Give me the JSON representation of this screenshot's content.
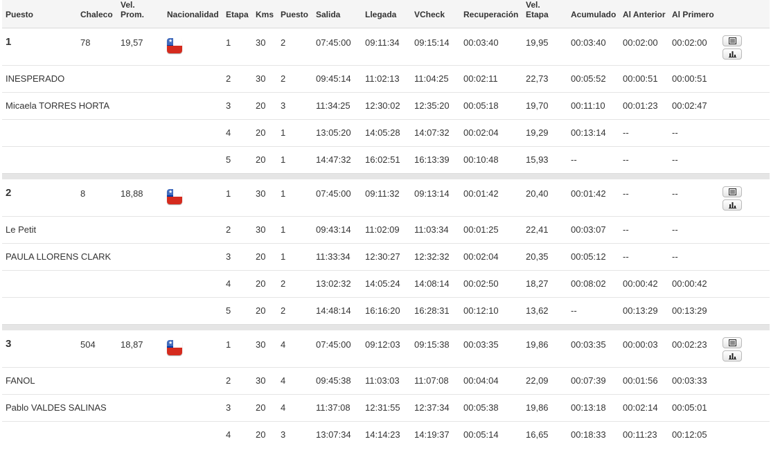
{
  "table": {
    "headers": [
      "Puesto",
      "Chaleco",
      "Vel.\nProm.",
      "Nacionalidad",
      "Etapa",
      "Kms",
      "Puesto",
      "Salida",
      "Llegada",
      "VCheck",
      "Recuperación",
      "Vel.\nEtapa",
      "Acumulado",
      "Al Anterior",
      "Al Primero"
    ],
    "groups": [
      {
        "position": "1",
        "bib": "78",
        "avg_speed": "19,57",
        "nationality_flag": "chile-flag-icon",
        "names": [
          "INESPERADO",
          "Micaela TORRES HORTA"
        ],
        "stages": [
          [
            "1",
            "30",
            "2",
            "07:45:00",
            "09:11:34",
            "09:15:14",
            "00:03:40",
            "19,95",
            "00:03:40",
            "00:02:00",
            "00:02:00"
          ],
          [
            "2",
            "30",
            "2",
            "09:45:14",
            "11:02:13",
            "11:04:25",
            "00:02:11",
            "22,73",
            "00:05:52",
            "00:00:51",
            "00:00:51"
          ],
          [
            "3",
            "20",
            "3",
            "11:34:25",
            "12:30:02",
            "12:35:20",
            "00:05:18",
            "19,70",
            "00:11:10",
            "00:01:23",
            "00:02:47"
          ],
          [
            "4",
            "20",
            "1",
            "13:05:20",
            "14:05:28",
            "14:07:32",
            "00:02:04",
            "19,29",
            "00:13:14",
            "--",
            "--"
          ],
          [
            "5",
            "20",
            "1",
            "14:47:32",
            "16:02:51",
            "16:13:39",
            "00:10:48",
            "15,93",
            "--",
            "--",
            "--"
          ]
        ]
      },
      {
        "position": "2",
        "bib": "8",
        "avg_speed": "18,88",
        "nationality_flag": "chile-flag-icon",
        "names": [
          "Le Petit",
          "PAULA LLORENS CLARK"
        ],
        "stages": [
          [
            "1",
            "30",
            "1",
            "07:45:00",
            "09:11:32",
            "09:13:14",
            "00:01:42",
            "20,40",
            "00:01:42",
            "--",
            "--"
          ],
          [
            "2",
            "30",
            "1",
            "09:43:14",
            "11:02:09",
            "11:03:34",
            "00:01:25",
            "22,41",
            "00:03:07",
            "--",
            "--"
          ],
          [
            "3",
            "20",
            "1",
            "11:33:34",
            "12:30:27",
            "12:32:32",
            "00:02:04",
            "20,35",
            "00:05:12",
            "--",
            "--"
          ],
          [
            "4",
            "20",
            "2",
            "13:02:32",
            "14:05:24",
            "14:08:14",
            "00:02:50",
            "18,27",
            "00:08:02",
            "00:00:42",
            "00:00:42"
          ],
          [
            "5",
            "20",
            "2",
            "14:48:14",
            "16:16:20",
            "16:28:31",
            "00:12:10",
            "13,62",
            "--",
            "00:13:29",
            "00:13:29"
          ]
        ]
      },
      {
        "position": "3",
        "bib": "504",
        "avg_speed": "18,87",
        "nationality_flag": "chile-flag-icon",
        "names": [
          "FANOL",
          "Pablo VALDES SALINAS"
        ],
        "stages": [
          [
            "1",
            "30",
            "4",
            "07:45:00",
            "09:12:03",
            "09:15:38",
            "00:03:35",
            "19,86",
            "00:03:35",
            "00:00:03",
            "00:02:23"
          ],
          [
            "2",
            "30",
            "4",
            "09:45:38",
            "11:03:03",
            "11:07:08",
            "00:04:04",
            "22,09",
            "00:07:39",
            "00:01:56",
            "00:03:33"
          ],
          [
            "3",
            "20",
            "4",
            "11:37:08",
            "12:31:55",
            "12:37:34",
            "00:05:38",
            "19,86",
            "00:13:18",
            "00:02:14",
            "00:05:01"
          ],
          [
            "4",
            "20",
            "3",
            "13:07:34",
            "14:14:23",
            "14:19:37",
            "00:05:14",
            "16,65",
            "00:18:33",
            "00:11:23",
            "00:12:05"
          ]
        ]
      }
    ],
    "actions": [
      "table-view-icon",
      "bar-chart-icon"
    ]
  },
  "colors": {
    "flag_blue": "#0039a6",
    "flag_red": "#d52b1e",
    "header_bg": "#f5f5f5",
    "separator": "#e5e5e5"
  }
}
